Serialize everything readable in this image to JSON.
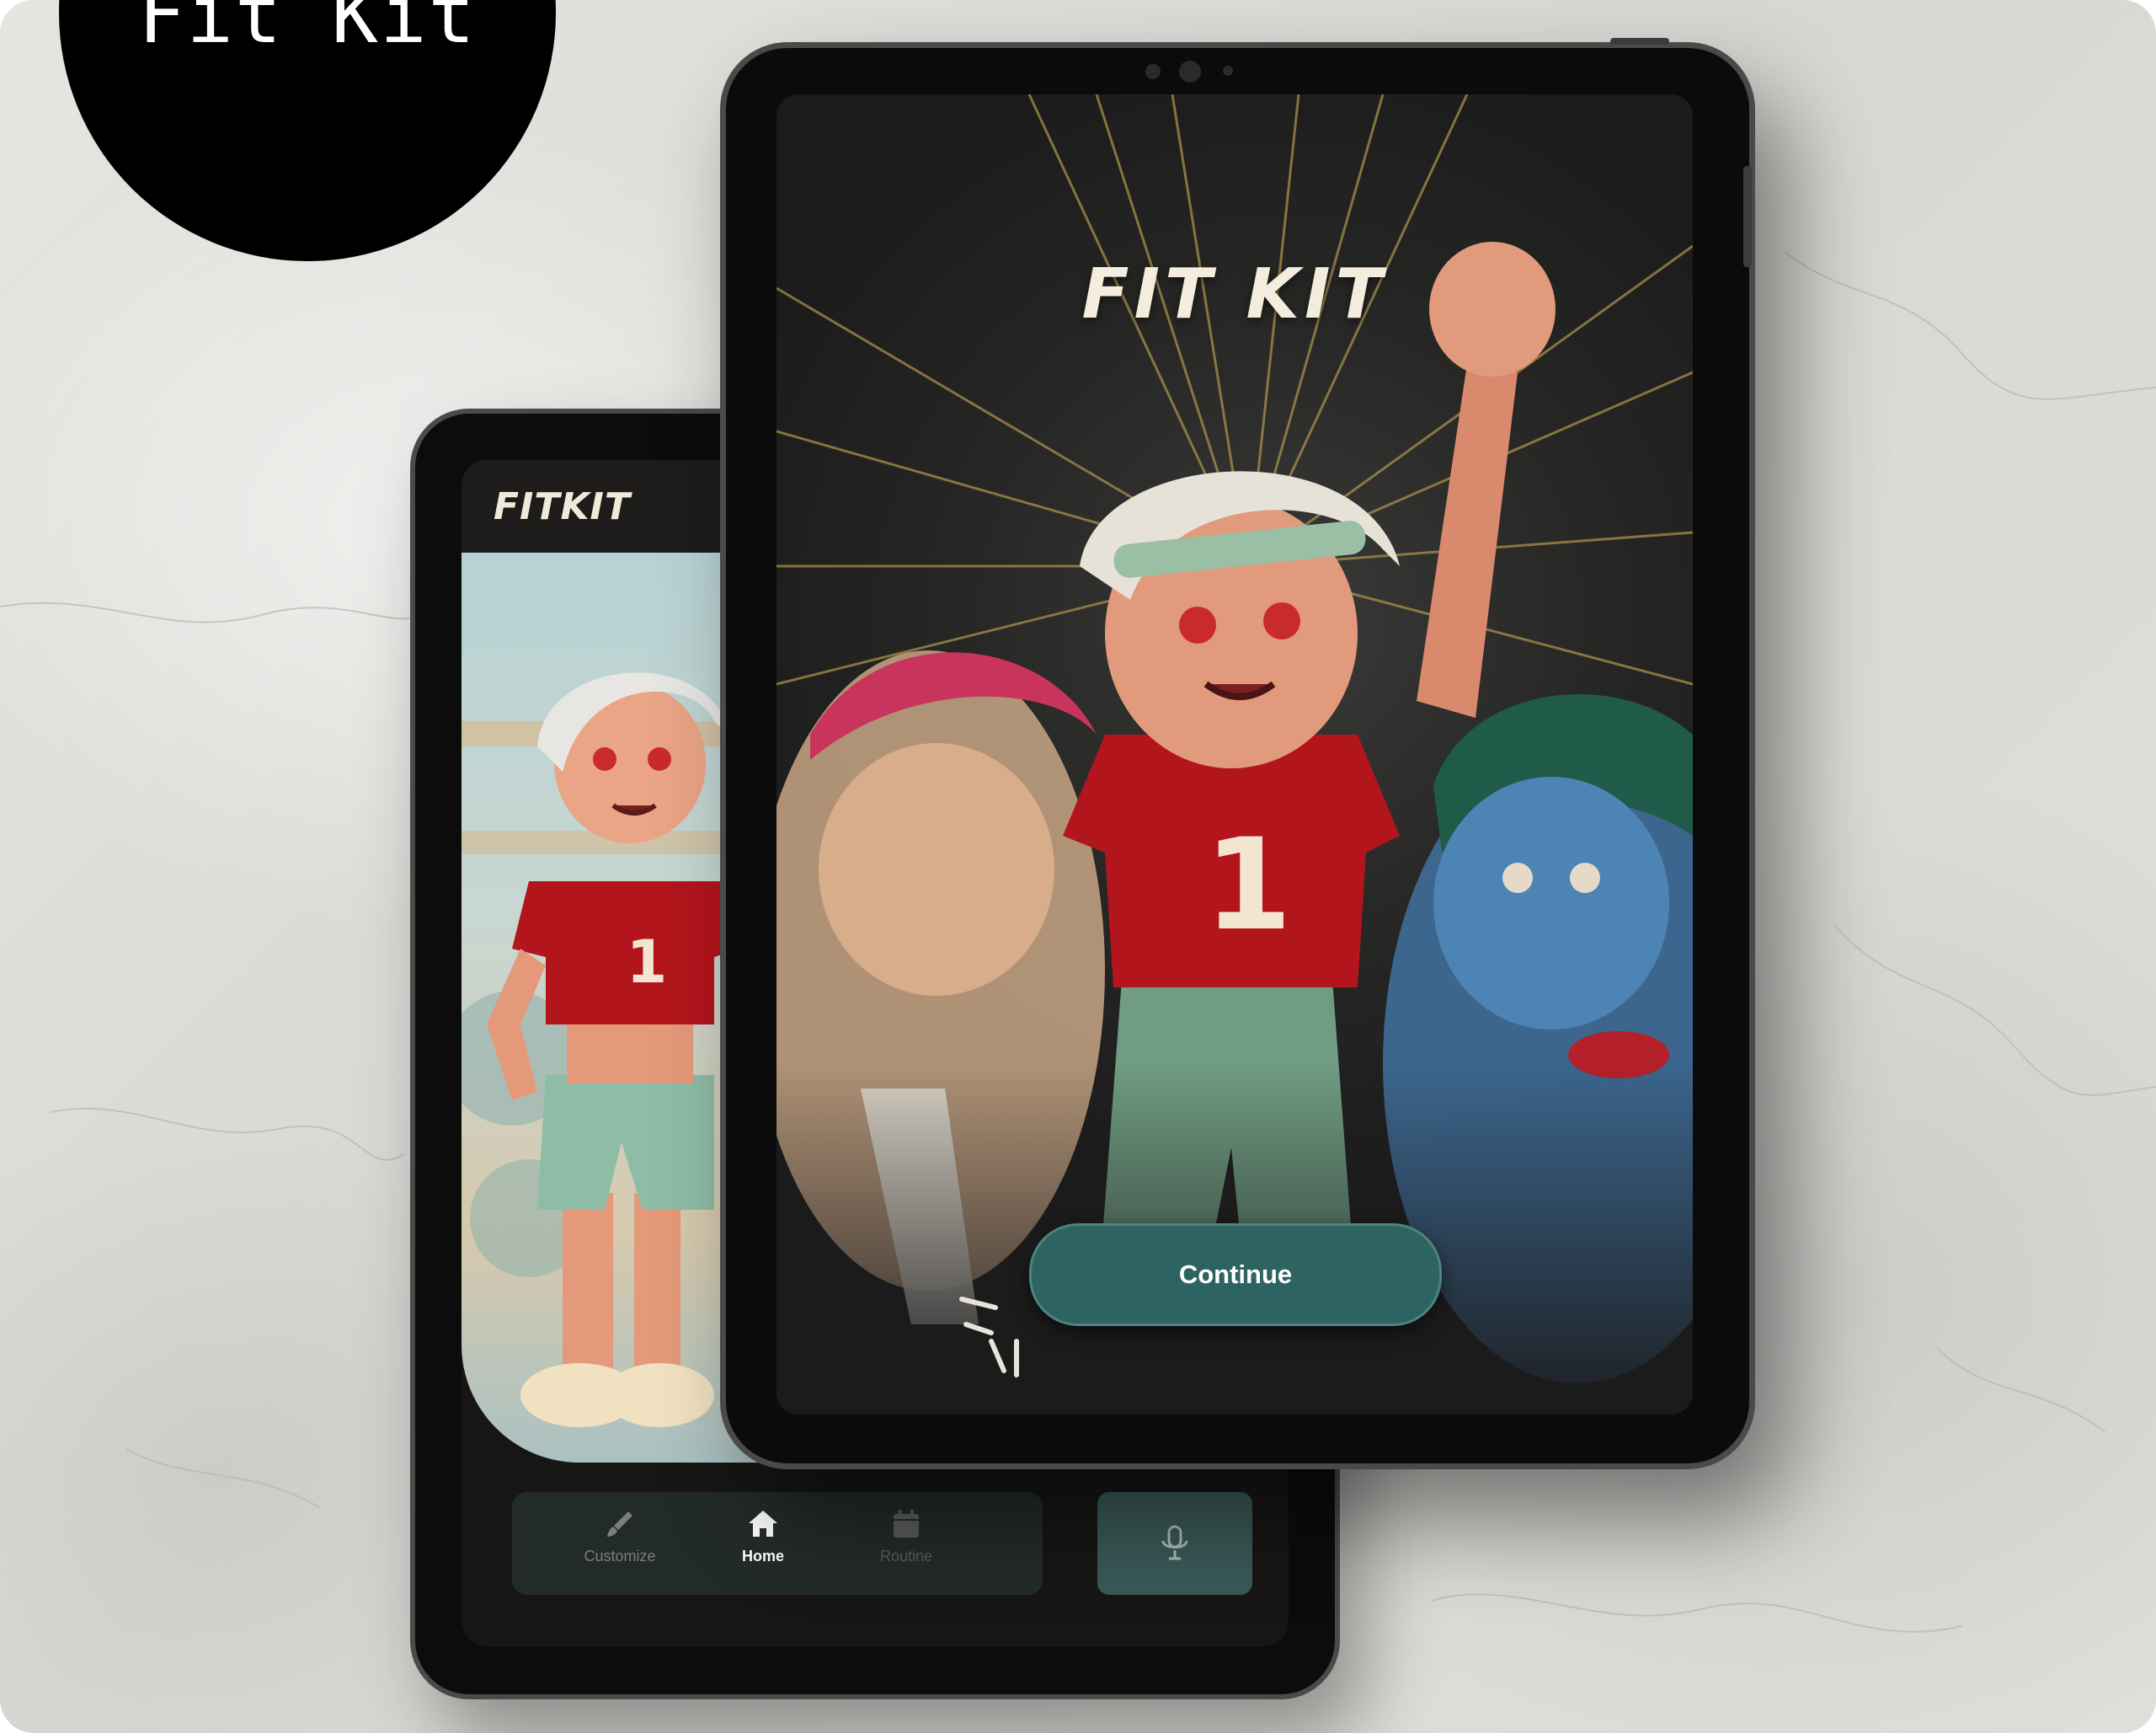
{
  "badge": {
    "text": "Fit Kit"
  },
  "back_device": {
    "logo": "FITKIT",
    "nav": {
      "customize_label": "Customize",
      "home_label": "Home",
      "routine_label": "Routine",
      "active": "Home"
    },
    "icons": [
      "brush-icon",
      "home-icon",
      "calendar-icon",
      "microphone-icon"
    ]
  },
  "front_device": {
    "title": "FIT KIT",
    "continue_label": "Continue",
    "shirt_number": "1"
  },
  "colors": {
    "accent": "#2d6462",
    "mic_button": "#3a5957",
    "shirt_red": "#b3151c",
    "screen_dark": "#1b1b1b"
  }
}
